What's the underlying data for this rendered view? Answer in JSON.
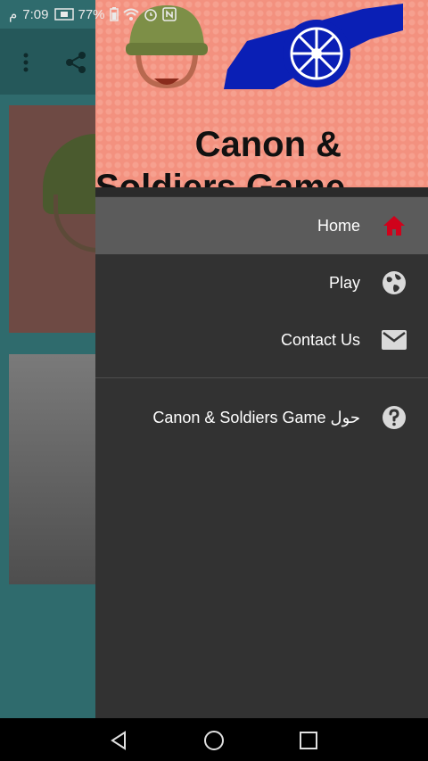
{
  "status_bar": {
    "time": "7:09",
    "carrier": "م",
    "battery": "77%"
  },
  "drawer": {
    "header_title": "Canon &\nSoldiers Game",
    "items": [
      {
        "label": "Home",
        "icon": "home-icon",
        "active": true
      },
      {
        "label": "Play",
        "icon": "globe-icon"
      },
      {
        "label": "Contact Us",
        "icon": "mail-icon"
      },
      {
        "label": "Canon & Soldiers Game حول",
        "icon": "help-icon"
      }
    ]
  },
  "colors": {
    "active_icon": "#d0021b",
    "drawer_bg": "#323232",
    "header_bg": "#f3917f",
    "cannon": "#0a1fb5"
  }
}
